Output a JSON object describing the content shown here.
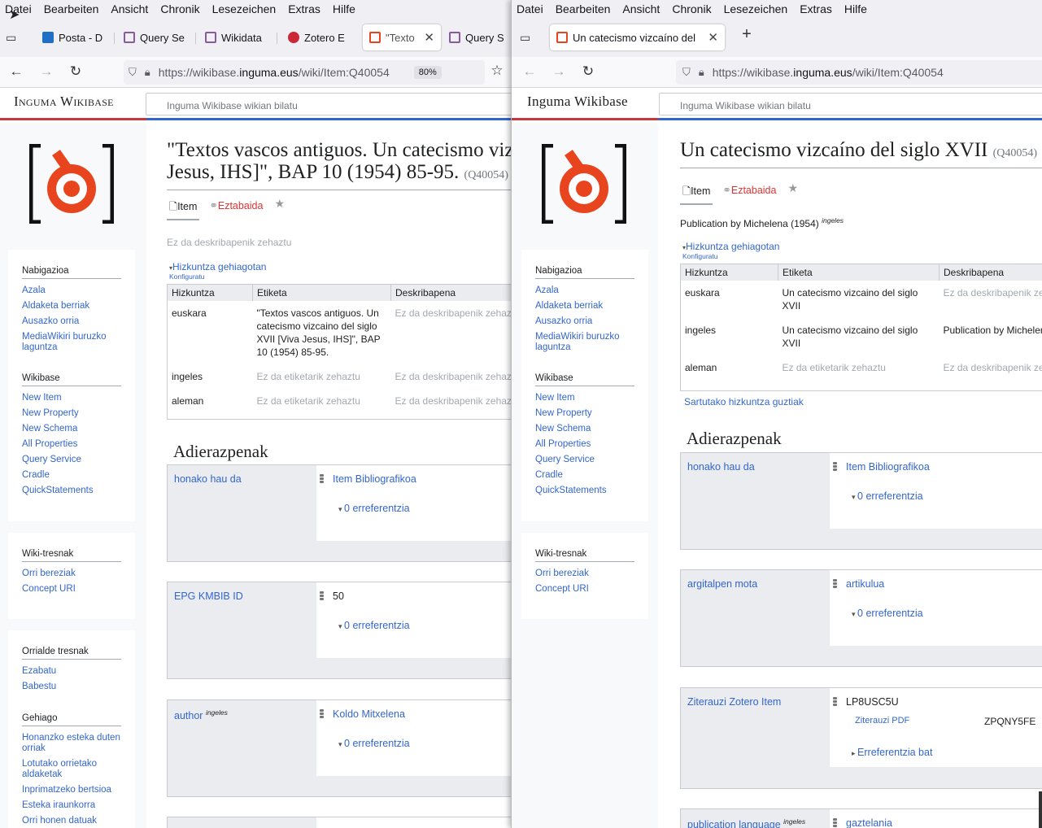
{
  "left": {
    "menu": [
      "Datei",
      "Bearbeiten",
      "Ansicht",
      "Chronik",
      "Lesezeichen",
      "Extras",
      "Hilfe"
    ],
    "tabs": [
      "Posta - D",
      "Query Se",
      "Wikidata",
      "Zotero E",
      "\"Texto",
      "Query S"
    ],
    "url": {
      "prefix": "https://wikibase.",
      "host": "inguma.eus",
      "path": "/wiki/Item:Q40054"
    },
    "zoom": "80%",
    "site_name": "Inguma Wikibase",
    "search_placeholder": "Inguma Wikibase wikian bilatu",
    "title": "\"Textos vascos antiguos. Un catecismo vizc",
    "title2": "Jesus, IHS]\", BAP 10 (1954) 85-95.",
    "qid": "(Q40054)",
    "tab_item": "Item",
    "tab_disc": "Eztabaida",
    "description": "Ez da deskribapenik zehaztu",
    "more_langs": "Hizkuntza gehiagotan",
    "configure": "Konfiguratu",
    "table_headers": [
      "Hizkuntza",
      "Etiketa",
      "Deskribapena"
    ],
    "rows": [
      {
        "lang": "euskara",
        "label": "\"Textos vascos antiguos. Un catecismo vizcaino del siglo XVII [Viva Jesus, IHS]\", BAP 10 (1954) 85-95.",
        "desc": "Ez da deskribapenik zehaz"
      },
      {
        "lang": "ingeles",
        "label": "Ez da etiketarik zehaztu",
        "desc": "Ez da deskribapenik zehaz"
      },
      {
        "lang": "aleman",
        "label": "Ez da etiketarik zehaztu",
        "desc": "Ez da deskribapenik zehaz"
      }
    ],
    "statements_title": "Adierazpenak",
    "statements": [
      {
        "prop": "honako hau da",
        "sup": "",
        "value": "Item Bibliografikoa",
        "refs": "0 erreferentzia"
      },
      {
        "prop": "EPG KMBIB ID",
        "sup": "",
        "value": "50",
        "refs": "0 erreferentzia"
      },
      {
        "prop": "author",
        "sup": "ingeles",
        "value": "Koldo Mitxelena",
        "refs": "0 erreferentzia"
      }
    ],
    "nav_heading": "Nabigazioa",
    "nav": [
      "Azala",
      "Aldaketa berriak",
      "Ausazko orria",
      "MediaWikiri buruzko laguntza"
    ],
    "wb_heading": "Wikibase",
    "wb": [
      "New Item",
      "New Property",
      "New Schema",
      "All Properties",
      "Query Service",
      "Cradle",
      "QuickStatements"
    ],
    "tools_heading": "Wiki-tresnak",
    "tools": [
      "Orri bereziak",
      "Concept URI"
    ],
    "page_tools_heading": "Orrialde tresnak",
    "page_tools": [
      "Ezabatu",
      "Babestu"
    ],
    "more_heading": "Gehiago",
    "more": [
      "Honanzko esteka duten orriak",
      "Lotutako orrietako aldaketak",
      "Inprimatzeko bertsioa",
      "Esteka iraunkorra",
      "Orri honen datuak"
    ]
  },
  "right": {
    "menu": [
      "Datei",
      "Bearbeiten",
      "Ansicht",
      "Chronik",
      "Lesezeichen",
      "Extras",
      "Hilfe"
    ],
    "tab": "Un catecismo vizcaíno del",
    "url": {
      "prefix": "https://wikibase.",
      "host": "inguma.eus",
      "path": "/wiki/Item:Q40054"
    },
    "site_name": "Inguma Wikibase",
    "search_placeholder": "Inguma Wikibase wikian bilatu",
    "title": "Un catecismo vizcaíno del siglo XVII",
    "qid": "(Q40054)",
    "tab_item": "Item",
    "tab_disc": "Eztabaida",
    "description": "Publication by Michelena (1954)",
    "description_sup": "ingeles",
    "more_langs": "Hizkuntza gehiagotan",
    "configure": "Konfiguratu",
    "table_headers": [
      "Hizkuntza",
      "Etiketa",
      "Deskribapena"
    ],
    "rows": [
      {
        "lang": "euskara",
        "label": "Un catecismo vizcaino del siglo XVII",
        "desc": "Ez da deskribapenik ze",
        "muted": true
      },
      {
        "lang": "ingeles",
        "label": "Un catecismo vizcaino del siglo XVII",
        "desc": "Publication by Micheler",
        "muted": false
      },
      {
        "lang": "aleman",
        "label": "Ez da etiketarik zehaztu",
        "desc": "Ez da deskribapenik ze",
        "muted": true
      }
    ],
    "all_langs": "Sartutako hizkuntza guztiak",
    "statements_title": "Adierazpenak",
    "statements": [
      {
        "prop": "honako hau da",
        "value": "Item Bibliografikoa",
        "refs": "0 erreferentzia"
      },
      {
        "prop": "argitalpen mota",
        "value": "artikulua",
        "refs": "0 erreferentzia"
      },
      {
        "prop": "Ziterauzi Zotero Item",
        "value": "LP8USC5U",
        "qual_prop": "Ziterauzi PDF",
        "qual_value": "ZPQNY5FE",
        "refs": "Erreferentzia bat"
      },
      {
        "prop": "publication language",
        "sup": "ingeles",
        "value": "gaztelania"
      }
    ],
    "nav_heading": "Nabigazioa",
    "nav": [
      "Azala",
      "Aldaketa berriak",
      "Ausazko orria",
      "MediaWikiri buruzko laguntza"
    ],
    "wb_heading": "Wikibase",
    "wb": [
      "New Item",
      "New Property",
      "New Schema",
      "All Properties",
      "Query Service",
      "Cradle",
      "QuickStatements"
    ],
    "tools_heading": "Wiki-tresnak",
    "tools": [
      "Orri bereziak",
      "Concept URI"
    ]
  },
  "colors": {
    "accent": "#3366cc",
    "red": "#c8373c",
    "logo_red": "#e8451f"
  }
}
